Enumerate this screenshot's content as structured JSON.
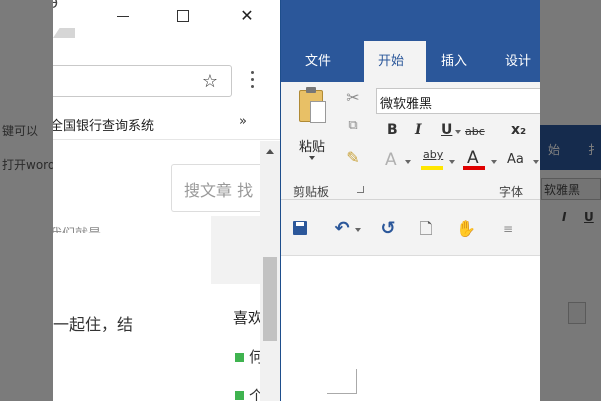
{
  "background": {
    "left_lines": [
      "键可以",
      "打开word"
    ],
    "right_labels": [
      "始",
      "扌",
      "软雅黑",
      "I",
      "U"
    ]
  },
  "browser": {
    "window_controls": {
      "minimize": "—",
      "maximize": "☐",
      "close": "✕"
    },
    "bookmark_bar": {
      "items": [
        "全国银行查询系统"
      ],
      "overflow": "»"
    },
    "page": {
      "search_placeholder": "搜文章 找",
      "partial_line": "我们就是",
      "article_text": "一起住，结",
      "sidebar_heading": "喜欢",
      "sidebar_items": [
        "何",
        "个"
      ]
    }
  },
  "word": {
    "ribbon_tabs": [
      "文件",
      "开始",
      "插入",
      "设计"
    ],
    "active_tab": "开始",
    "clipboard": {
      "paste_label": "粘贴",
      "group_label": "剪贴板"
    },
    "font": {
      "name": "微软雅黑",
      "group_label": "字体",
      "buttons": {
        "bold": "B",
        "italic": "I",
        "underline": "U",
        "strikethrough": "abc",
        "subscript": "x₂",
        "text_effects": "A",
        "highlight": "aby",
        "font_color": "A",
        "change_case": "Aa"
      }
    },
    "quick_access": {
      "icons": [
        "save-icon",
        "undo-icon",
        "redo-icon",
        "print-preview-icon",
        "touch-mode-icon",
        "customize-icon"
      ]
    },
    "colors": {
      "brand": "#2b579a",
      "highlight": "#ffe600",
      "font_color": "#e00000"
    }
  }
}
